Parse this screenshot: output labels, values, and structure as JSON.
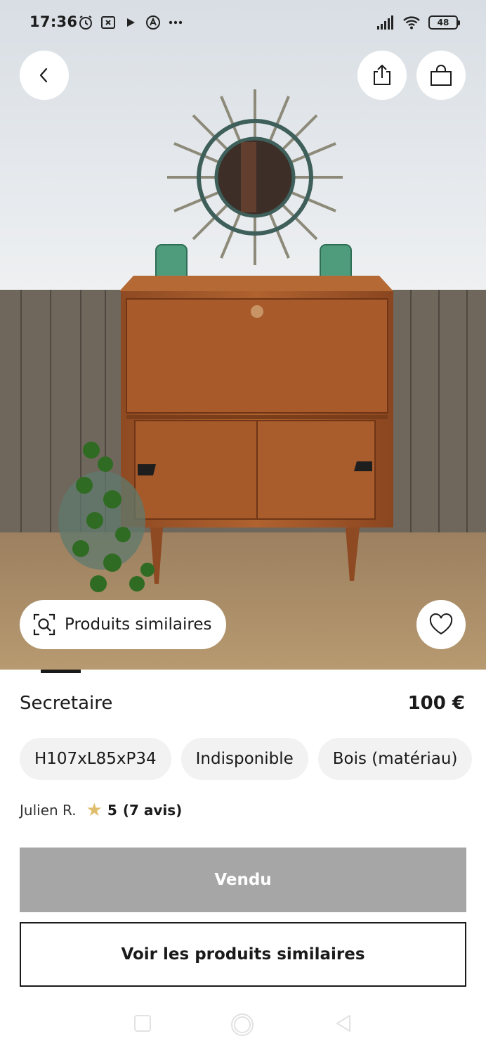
{
  "status_bar": {
    "time": "17:36",
    "left_icons": [
      "alarm-icon",
      "app-notification-icon",
      "play-icon",
      "app-notification-icon",
      "more-dots-icon"
    ],
    "right_icons": [
      "signal-icon",
      "wifi-icon"
    ],
    "battery": "48"
  },
  "photo": {
    "subject": "secretaire",
    "colors": {
      "wall": "#e3e7ea",
      "wood_panel": "#6c6459",
      "floor": "#a98d66",
      "cabinet": "#a0522d"
    }
  },
  "header_buttons": {
    "back_icon": "chevron-left-icon",
    "share_icon": "share-icon",
    "bag_icon": "shopping-bag-icon"
  },
  "overlay": {
    "similar_label": "Produits similaires",
    "similar_icon": "visual-search-icon",
    "favorite_icon": "heart-icon"
  },
  "carousel": {
    "current_index": 1
  },
  "product": {
    "title": "Secretaire",
    "price": "100 €",
    "chips": [
      "H107xL85xP34",
      "Indisponible",
      "Bois (matériau)"
    ]
  },
  "seller": {
    "name": "Julien R.",
    "rating": "5",
    "reviews": "(7 avis)"
  },
  "actions": {
    "sold_label": "Vendu",
    "similar_label": "Voir les produits similaires"
  },
  "navbar": {
    "icons": [
      "recents-square-icon",
      "home-circle-icon",
      "back-triangle-icon"
    ]
  },
  "colors": {
    "sold_button": "#a6a6a6",
    "star": "#e0bd6c",
    "chip_bg": "#f2f2f2"
  }
}
